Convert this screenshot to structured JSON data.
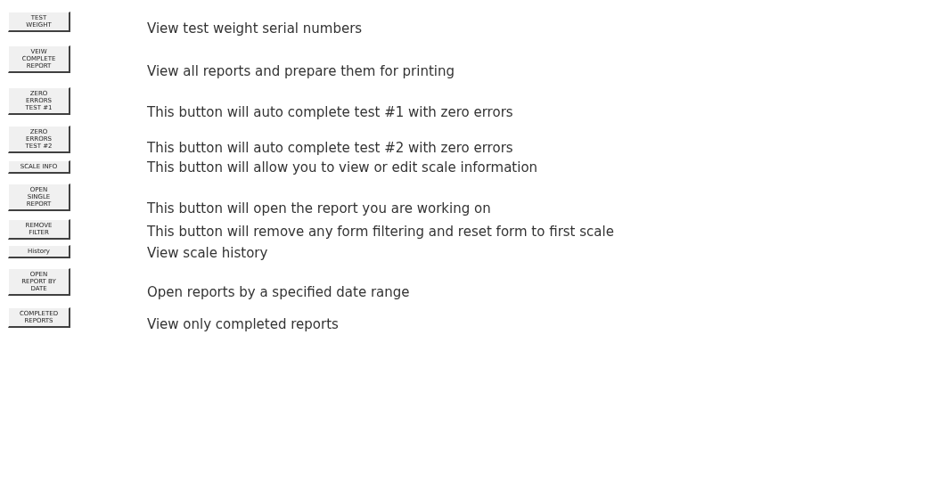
{
  "rows": [
    {
      "button": [
        "TEST",
        "WEIGHT"
      ],
      "description": "View test weight serial numbers"
    },
    {
      "button": [
        "VEIW",
        "COMPLETE",
        "REPORT"
      ],
      "description": "View all reports and prepare them for printing"
    },
    {
      "button": [
        "ZERO",
        "ERRORS",
        "TEST #1"
      ],
      "description": "This button will auto complete test #1 with zero errors"
    },
    {
      "button": [
        "ZERO",
        "ERRORS",
        "TEST #2"
      ],
      "description": "This button will auto complete test #2 with zero errors"
    },
    {
      "button": [
        "SCALE INFO"
      ],
      "description": "This button will allow you to view or edit scale information"
    },
    {
      "button": [
        "OPEN",
        "SINGLE",
        "REPORT"
      ],
      "description": "This button will open the report you are working on"
    },
    {
      "button": [
        "REMOVE",
        "FILTER"
      ],
      "description": "This button will remove any form filtering and reset form to first scale"
    },
    {
      "button": [
        "History"
      ],
      "description": "View scale history"
    },
    {
      "button": [
        "OPEN",
        "REPORT BY",
        "DATE"
      ],
      "description": "Open reports by a specified date range"
    },
    {
      "button": [
        "COMPLETED",
        "REPORTS"
      ],
      "description": "View only completed reports"
    }
  ]
}
